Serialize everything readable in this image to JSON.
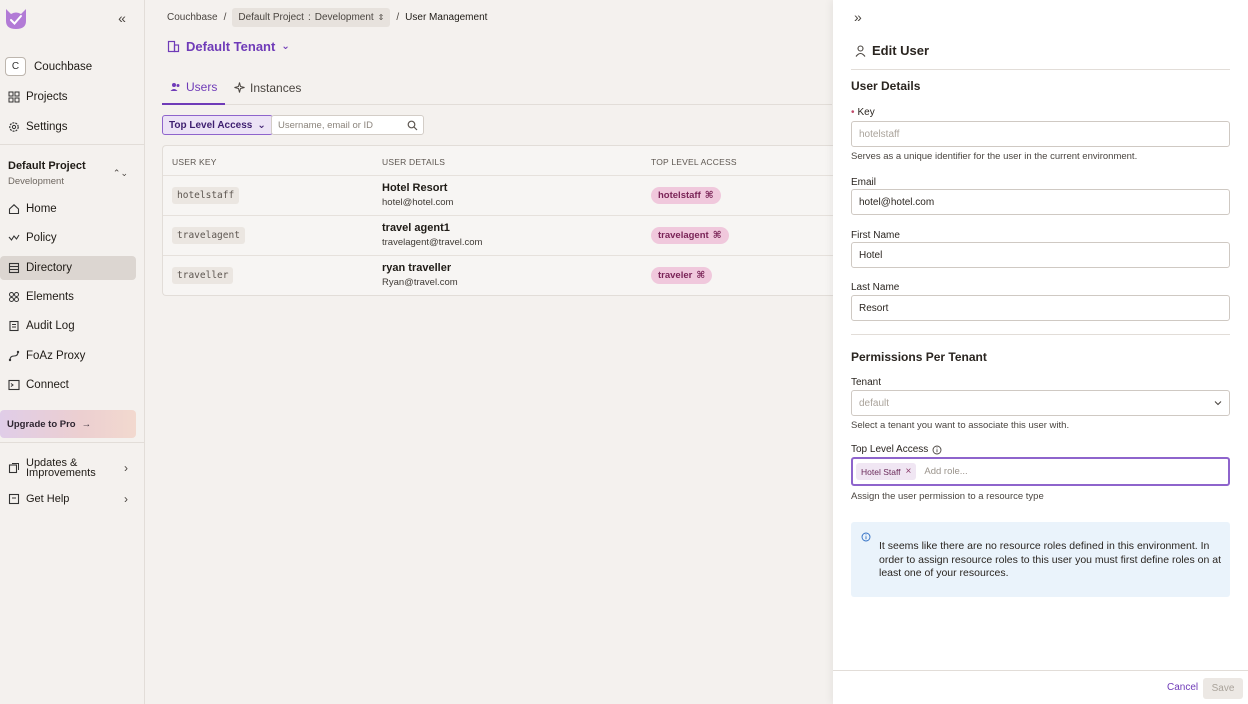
{
  "sidebar": {
    "org": {
      "badge": "C",
      "name": "Couchbase"
    },
    "top_items": [
      {
        "label": "Projects",
        "icon": "grid-icon"
      },
      {
        "label": "Settings",
        "icon": "gear-icon"
      }
    ],
    "project": {
      "name": "Default Project",
      "env": "Development"
    },
    "items": [
      {
        "label": "Home",
        "icon": "home-icon"
      },
      {
        "label": "Policy",
        "icon": "policy-icon"
      },
      {
        "label": "Directory",
        "icon": "directory-icon",
        "active": true
      },
      {
        "label": "Elements",
        "icon": "elements-icon"
      },
      {
        "label": "Audit Log",
        "icon": "audit-log-icon"
      },
      {
        "label": "FoAz Proxy",
        "icon": "proxy-icon"
      },
      {
        "label": "Connect",
        "icon": "terminal-icon"
      }
    ],
    "upgrade_label": "Upgrade to Pro",
    "updates_label_1": "Updates &",
    "updates_label_2": "Improvements",
    "help_label": "Get Help"
  },
  "breadcrumb": {
    "org": "Couchbase",
    "project": "Default Project",
    "sep": ":",
    "env": "Development",
    "current": "User Management"
  },
  "tenant": {
    "title": "Default Tenant"
  },
  "tabs": [
    {
      "label": "Users",
      "active": true
    },
    {
      "label": "Instances",
      "active": false
    }
  ],
  "toolbar": {
    "filter_label": "Top Level Access",
    "search_placeholder": "Username, email or ID"
  },
  "table": {
    "headers": [
      "User Key",
      "User Details",
      "Top Level Access"
    ],
    "rows": [
      {
        "key": "hotelstaff",
        "name": "Hotel Resort",
        "email": "hotel@hotel.com",
        "role": "hotelstaff"
      },
      {
        "key": "travelagent",
        "name": "travel agent1",
        "email": "travelagent@travel.com",
        "role": "travelagent"
      },
      {
        "key": "traveller",
        "name": "ryan traveller",
        "email": "Ryan@travel.com",
        "role": "traveler"
      }
    ]
  },
  "drawer": {
    "title": "Edit User",
    "user_details_title": "User Details",
    "key_label": "Key",
    "key_placeholder": "hotelstaff",
    "key_helper": "Serves as a unique identifier for the user in the current environment.",
    "email_label": "Email",
    "email_value": "hotel@hotel.com",
    "first_name_label": "First Name",
    "first_name_value": "Hotel",
    "last_name_label": "Last Name",
    "last_name_value": "Resort",
    "permissions_title": "Permissions Per Tenant",
    "tenant_label": "Tenant",
    "tenant_placeholder": "default",
    "tenant_helper": "Select a tenant you want to associate this user with.",
    "tla_label": "Top Level Access",
    "tla_tag": "Hotel Staff",
    "tla_placeholder": "Add role...",
    "tla_helper": "Assign the user permission to a resource type",
    "info_text": "It seems like there are no resource roles defined in this environment. In order to assign resource roles to this user you must first define roles on at least one of your resources.",
    "cancel_label": "Cancel",
    "save_label": "Save"
  },
  "colors": {
    "accent": "#6f3bb8",
    "role_chip_bg": "#f0c8dc",
    "info_bg": "#eaf3fb"
  }
}
